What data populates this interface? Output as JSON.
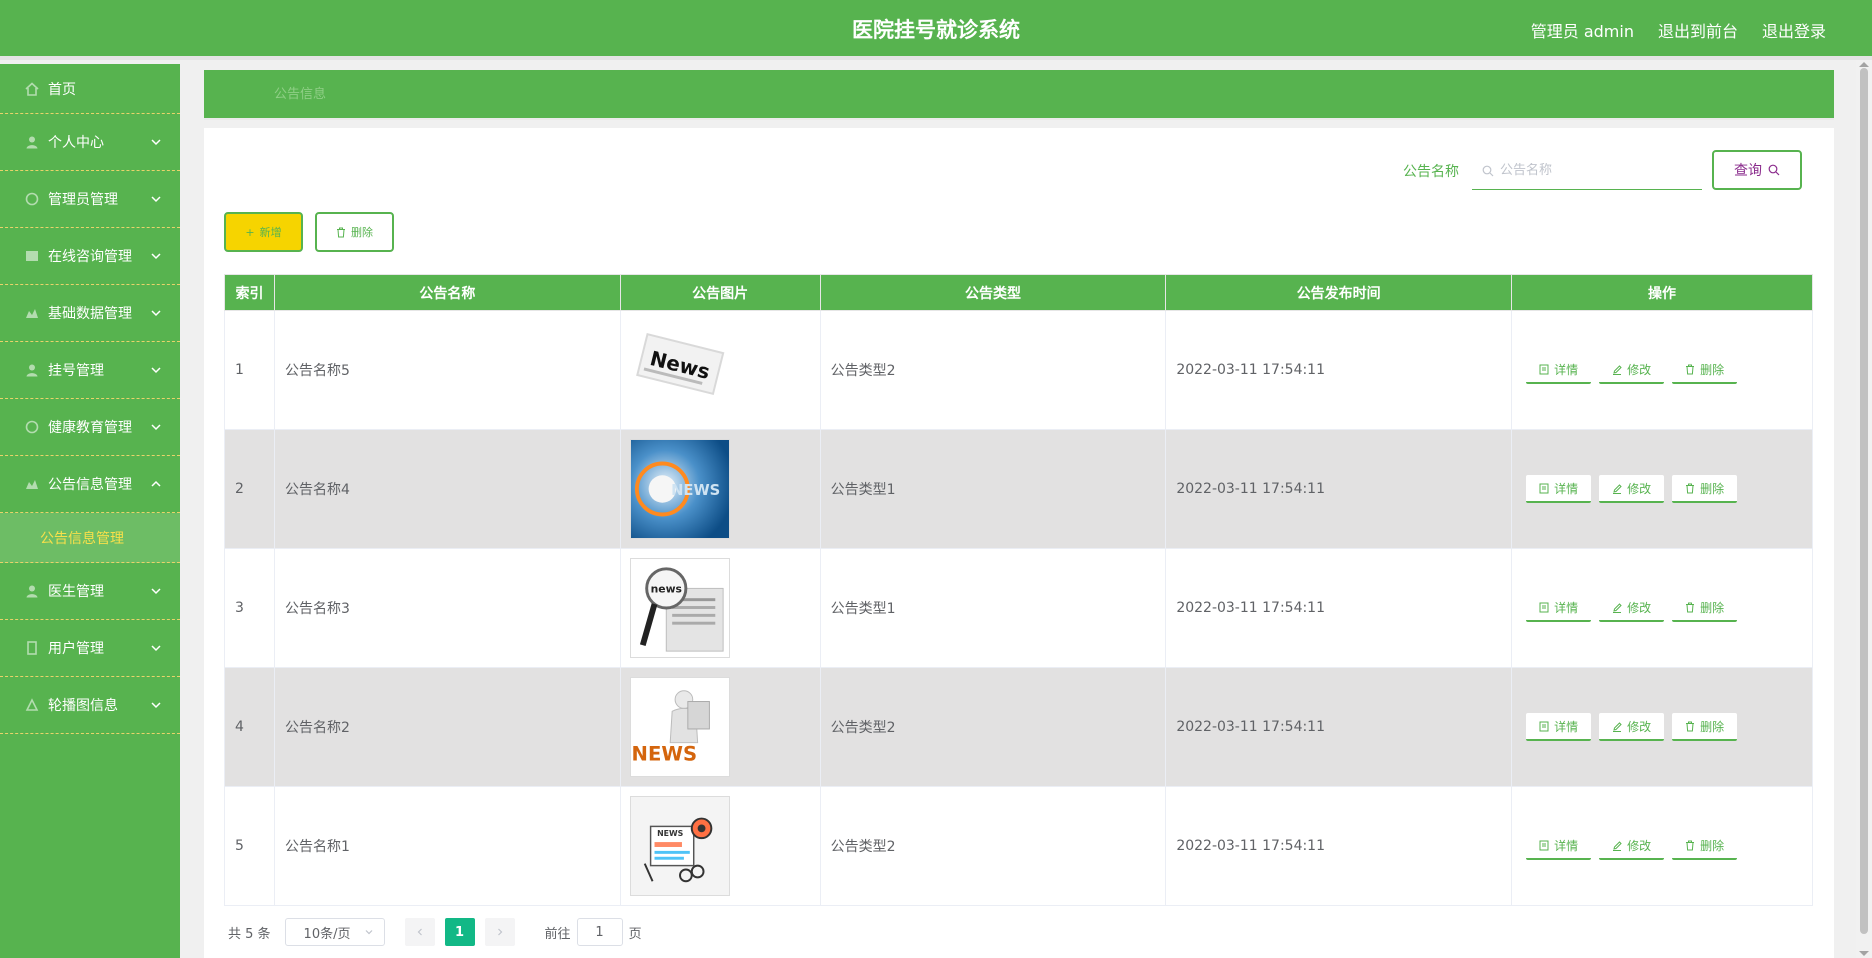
{
  "header": {
    "title": "医院挂号就诊系统",
    "user_label": "管理员 admin",
    "front_link": "退出到前台",
    "logout_link": "退出登录"
  },
  "sidebar": {
    "items": [
      {
        "label": "首页",
        "icon": "home-icon"
      },
      {
        "label": "个人中心",
        "icon": "user-icon"
      },
      {
        "label": "管理员管理",
        "icon": "admin-icon"
      },
      {
        "label": "在线咨询管理",
        "icon": "chat-icon"
      },
      {
        "label": "基础数据管理",
        "icon": "data-icon"
      },
      {
        "label": "挂号管理",
        "icon": "register-icon"
      },
      {
        "label": "健康教育管理",
        "icon": "education-icon"
      },
      {
        "label": "公告信息管理",
        "icon": "notice-icon"
      },
      {
        "label": "医生管理",
        "icon": "doctor-icon"
      },
      {
        "label": "用户管理",
        "icon": "users-icon"
      },
      {
        "label": "轮播图信息",
        "icon": "carousel-icon"
      }
    ],
    "active_submenu": "公告信息管理"
  },
  "breadcrumb": {
    "current": "公告信息"
  },
  "search": {
    "label": "公告名称",
    "placeholder": "公告名称",
    "button": "查询"
  },
  "toolbar": {
    "add_label": "新增",
    "delete_label": "删除"
  },
  "table": {
    "headers": [
      "索引",
      "公告名称",
      "公告图片",
      "公告类型",
      "公告发布时间",
      "操作"
    ],
    "rows": [
      {
        "index": "1",
        "name": "公告名称5",
        "type": "公告类型2",
        "time": "2022-03-11 17:54:11"
      },
      {
        "index": "2",
        "name": "公告名称4",
        "type": "公告类型1",
        "time": "2022-03-11 17:54:11"
      },
      {
        "index": "3",
        "name": "公告名称3",
        "type": "公告类型1",
        "time": "2022-03-11 17:54:11"
      },
      {
        "index": "4",
        "name": "公告名称2",
        "type": "公告类型2",
        "time": "2022-03-11 17:54:11"
      },
      {
        "index": "5",
        "name": "公告名称1",
        "type": "公告类型2",
        "time": "2022-03-11 17:54:11"
      }
    ],
    "actions": {
      "detail": "详情",
      "edit": "修改",
      "delete": "删除"
    }
  },
  "pagination": {
    "total": "共 5 条",
    "page_size": "10条/页",
    "current_page": "1",
    "goto_prefix": "前往",
    "goto_value": "1",
    "goto_suffix": "页"
  },
  "colors": {
    "primary": "#57b34f",
    "accent_yellow": "#f6d400",
    "pager_active": "#12b886",
    "even_row": "#e2e1e1"
  }
}
